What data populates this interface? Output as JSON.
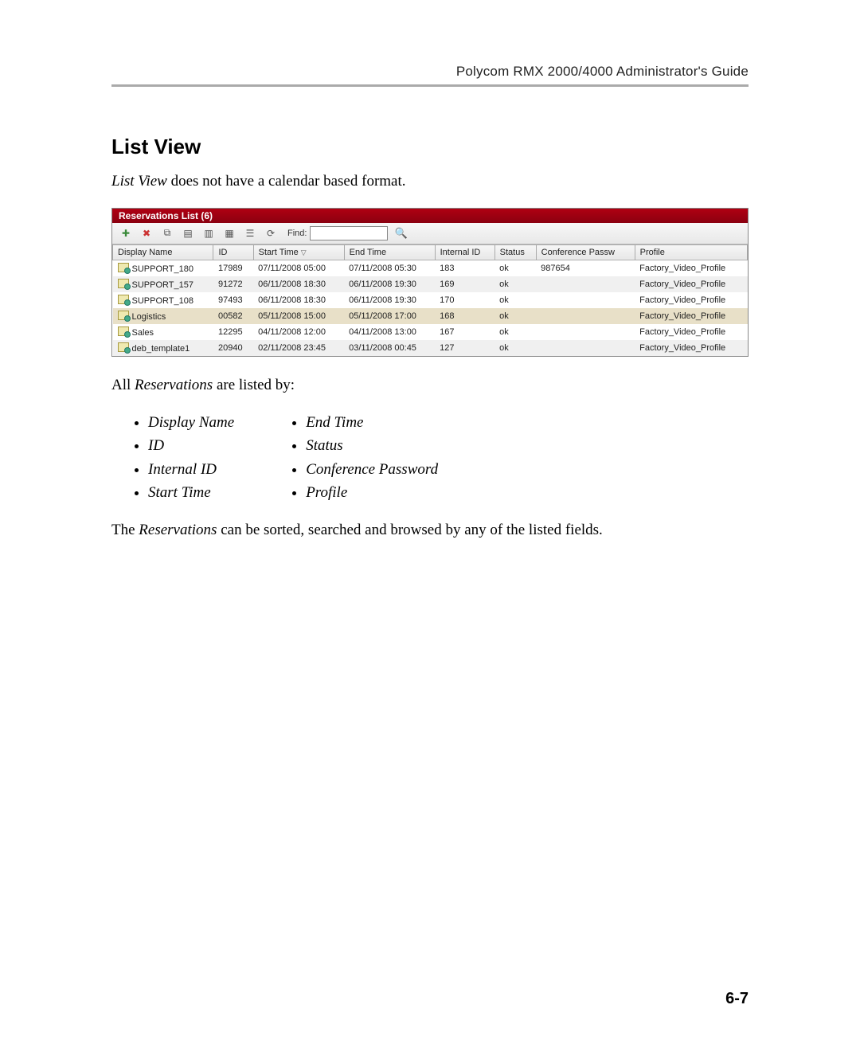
{
  "header": {
    "guide_title": "Polycom RMX 2000/4000 Administrator's Guide"
  },
  "section": {
    "title": "List View",
    "intro_prefix_italic": "List View",
    "intro_rest": " does not have a calendar based format.",
    "listed_prefix": "All ",
    "listed_italic": "Reservations",
    "listed_rest": " are listed by:",
    "footer_prefix": "The ",
    "footer_italic": "Reservations",
    "footer_rest": " can be sorted, searched and browsed by any of the listed fields."
  },
  "panel": {
    "title": "Reservations List (6)",
    "find_label": "Find:",
    "find_value": "",
    "columns": [
      "Display Name",
      "ID",
      "Start Time",
      "End Time",
      "Internal ID",
      "Status",
      "Conference Passw",
      "Profile"
    ],
    "sort_col_index": 2,
    "rows": [
      {
        "name": "SUPPORT_180",
        "id": "17989",
        "start": "07/11/2008 05:00",
        "end": "07/11/2008 05:30",
        "iid": "183",
        "status": "ok",
        "pw": "987654",
        "profile": "Factory_Video_Profile",
        "sel": false
      },
      {
        "name": "SUPPORT_157",
        "id": "91272",
        "start": "06/11/2008 18:30",
        "end": "06/11/2008 19:30",
        "iid": "169",
        "status": "ok",
        "pw": "",
        "profile": "Factory_Video_Profile",
        "sel": false
      },
      {
        "name": "SUPPORT_108",
        "id": "97493",
        "start": "06/11/2008 18:30",
        "end": "06/11/2008 19:30",
        "iid": "170",
        "status": "ok",
        "pw": "",
        "profile": "Factory_Video_Profile",
        "sel": false
      },
      {
        "name": "Logistics",
        "id": "00582",
        "start": "05/11/2008 15:00",
        "end": "05/11/2008 17:00",
        "iid": "168",
        "status": "ok",
        "pw": "",
        "profile": "Factory_Video_Profile",
        "sel": true
      },
      {
        "name": "Sales",
        "id": "12295",
        "start": "04/11/2008 12:00",
        "end": "04/11/2008 13:00",
        "iid": "167",
        "status": "ok",
        "pw": "",
        "profile": "Factory_Video_Profile",
        "sel": false
      },
      {
        "name": "deb_template1",
        "id": "20940",
        "start": "02/11/2008 23:45",
        "end": "03/11/2008 00:45",
        "iid": "127",
        "status": "ok",
        "pw": "",
        "profile": "Factory_Video_Profile",
        "sel": false
      }
    ],
    "toolbar_icons": [
      "new-reservation-icon",
      "delete-icon",
      "copy-icon",
      "calendar-day-icon",
      "calendar-week-icon",
      "calendar-month-icon",
      "list-view-icon",
      "refresh-icon"
    ]
  },
  "bullets": {
    "left": [
      "Display Name",
      "ID",
      "Internal ID",
      "Start Time"
    ],
    "right": [
      "End Time",
      "Status",
      "Conference Password",
      "Profile"
    ]
  },
  "page_number": "6-7"
}
